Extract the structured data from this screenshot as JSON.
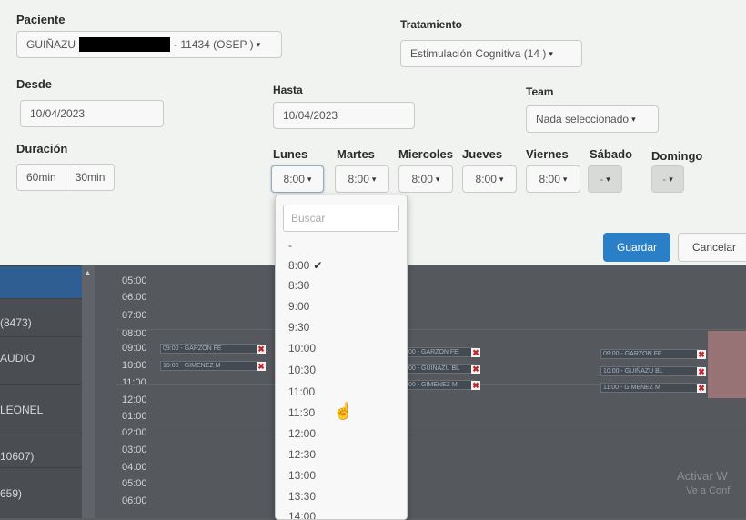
{
  "form": {
    "paciente_label": "Paciente",
    "paciente_prefix": "GUIÑAZU",
    "paciente_suffix": "- 11434 (OSEP )",
    "tratamiento_label": "Tratamiento",
    "tratamiento_value": "Estimulación Cognitiva (14 )",
    "desde_label": "Desde",
    "desde_value": "10/04/2023",
    "hasta_label": "Hasta",
    "hasta_value": "10/04/2023",
    "team_label": "Team",
    "team_value": "Nada seleccionado",
    "duracion_label": "Duración",
    "duracion_options": [
      "60min",
      "30min"
    ],
    "days": [
      {
        "label": "Lunes",
        "value": "8:00"
      },
      {
        "label": "Martes",
        "value": "8:00"
      },
      {
        "label": "Miercoles",
        "value": "8:00"
      },
      {
        "label": "Jueves",
        "value": "8:00"
      },
      {
        "label": "Viernes",
        "value": "8:00"
      },
      {
        "label": "Sábado",
        "value": "-"
      },
      {
        "label": "Domingo",
        "value": "-"
      }
    ],
    "guardar_label": "Guardar",
    "cancelar_label": "Cancelar"
  },
  "dropdown": {
    "search_placeholder": "Buscar",
    "options": [
      "-",
      "8:00",
      "8:30",
      "9:00",
      "9:30",
      "10:00",
      "10:30",
      "11:00",
      "11:30",
      "12:00",
      "12:30",
      "13:00",
      "13:30",
      "14:00"
    ],
    "selected": "8:00"
  },
  "calendar": {
    "rows": [
      "",
      "(8473)",
      "AUDIO",
      "LEONEL",
      "10607)",
      "659)"
    ],
    "hours": [
      "05:00",
      "06:00",
      "07:00",
      "08:00",
      "09:00",
      "10:00",
      "11:00",
      "12:00",
      "01:00",
      "02:00",
      "03:00",
      "04:00",
      "05:00",
      "06:00"
    ],
    "events": [
      "09:00 - GARZON FE",
      "10:00 - GIMENEZ M",
      "00 - GARZON FE",
      "00 - GUIÑAZU BL",
      "00 - GIMENEZ M",
      "09:00 - GARZON FE",
      "10:00 - GUIÑAZU BL",
      "11:00 - GIMENEZ M"
    ],
    "watermark_1": "Activar W",
    "watermark_2": "Ve a Confi"
  },
  "colors": {
    "primary": "#2a7fc6",
    "danger": "#c0262b",
    "selected_row": "#2f5e92"
  }
}
